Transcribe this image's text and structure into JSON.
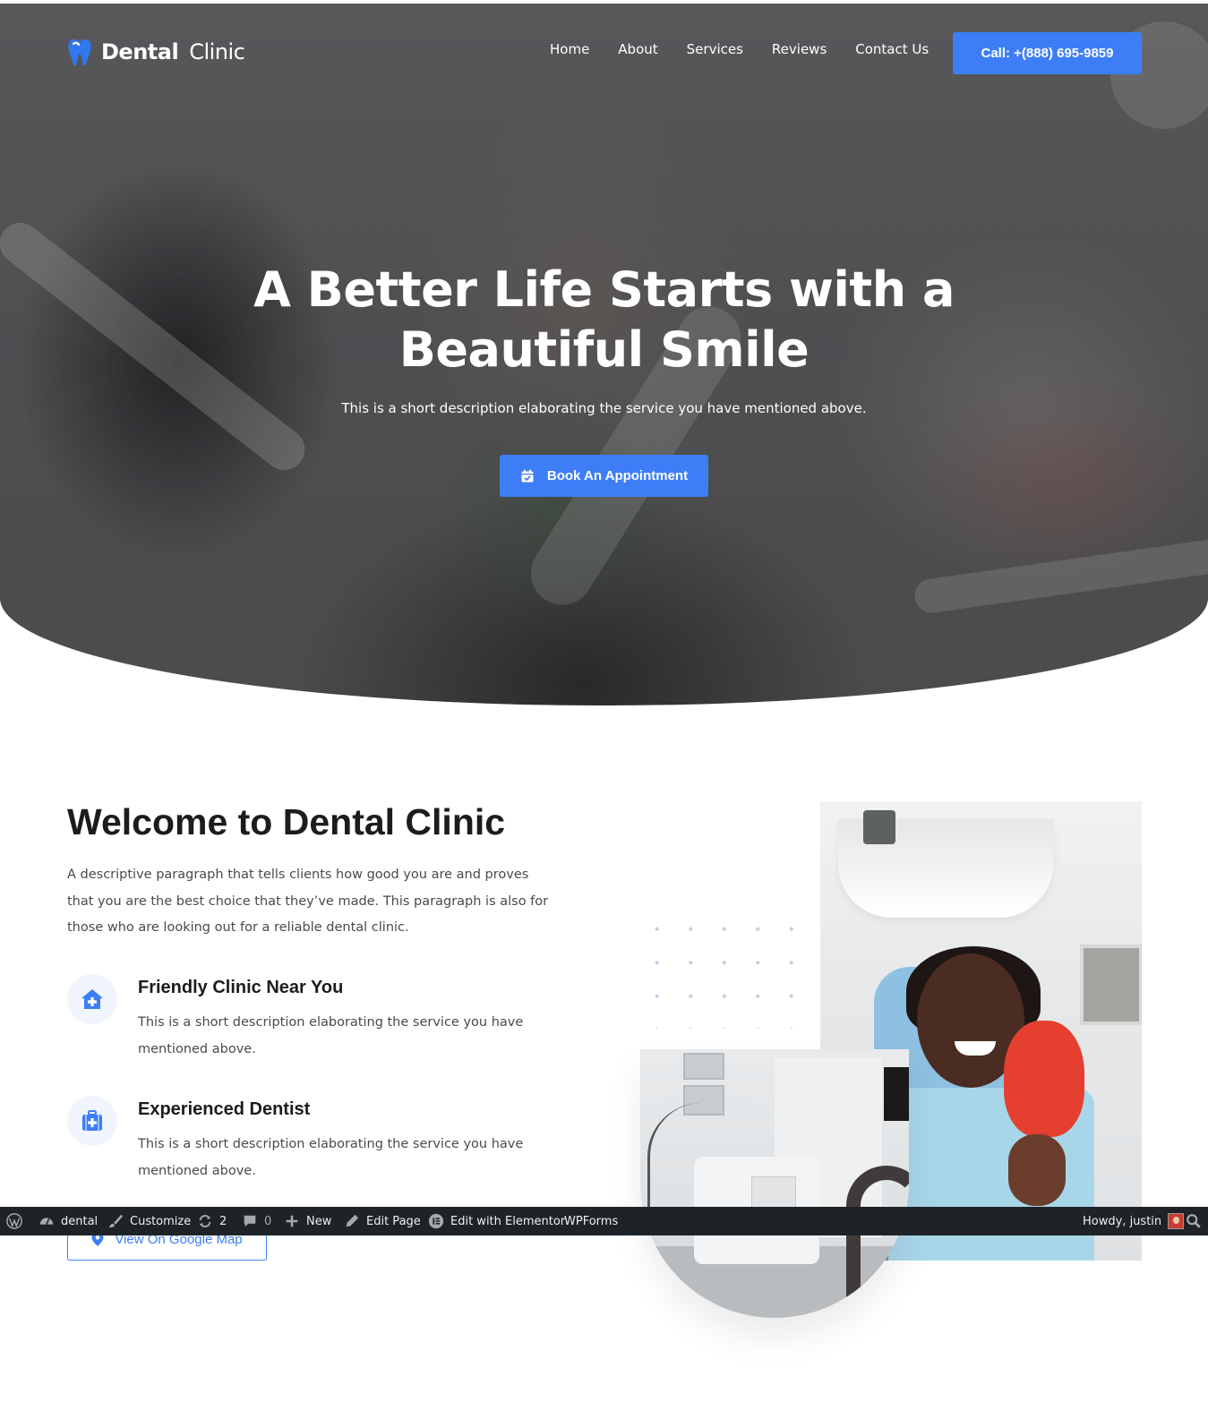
{
  "header": {
    "logo_bold": "Dental",
    "logo_light": "Clinic",
    "nav": [
      "Home",
      "About",
      "Services",
      "Reviews",
      "Contact Us"
    ],
    "call_button": "Call: +(888) 695-9859"
  },
  "hero": {
    "title_line1": "A Better Life Starts with a",
    "title_line2": "Beautiful Smile",
    "description": "This is a short description elaborating the service you have mentioned above.",
    "cta": "Book An Appointment",
    "cta_icon": "calendar-check-icon"
  },
  "welcome": {
    "title": "Welcome to Dental Clinic",
    "paragraph": "A descriptive paragraph that tells clients how good you are and proves that you are the best choice that they’ve made. This paragraph is also for those who are looking out for a reliable dental clinic.",
    "features": [
      {
        "icon": "clinic-house-icon",
        "title": "Friendly Clinic Near You",
        "description": "This is a short description elaborating the service you have mentioned above."
      },
      {
        "icon": "medical-kit-icon",
        "title": "Experienced Dentist",
        "description": "This is a short description elaborating the service you have mentioned above."
      }
    ],
    "map_button": "View On Google Map"
  },
  "admin_bar": {
    "site": "dental",
    "customize": "Customize",
    "updates": "2",
    "comments": "0",
    "new": "New",
    "edit_page": "Edit Page",
    "edit_elementor": "Edit with Elementor",
    "wpforms": "WPForms",
    "howdy": "Howdy, justin"
  },
  "colors": {
    "accent": "#3d7ef7",
    "admin_bar_bg": "#1d2327",
    "heading": "#1c1c1c",
    "body_text": "#4a4a4a"
  }
}
